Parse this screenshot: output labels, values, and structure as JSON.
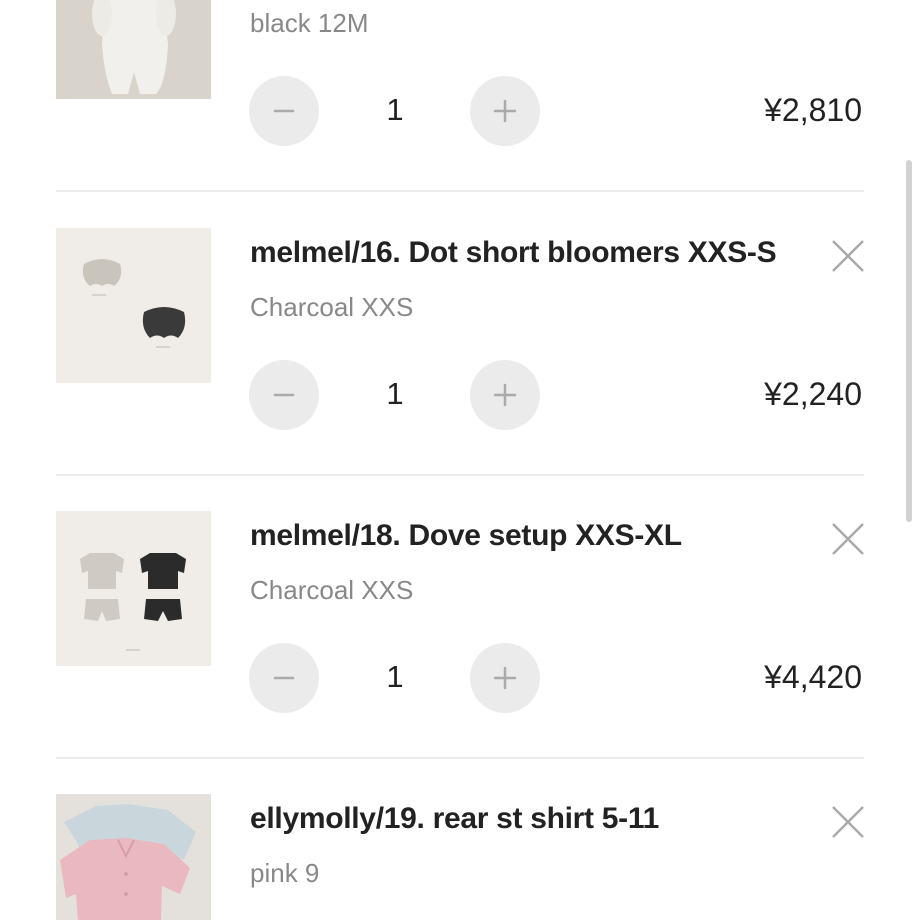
{
  "cart": {
    "items": [
      {
        "title": "",
        "variant": "black 12M",
        "quantity": "1",
        "price": "¥2,810"
      },
      {
        "title": "melmel/16. Dot short bloomers XXS-S",
        "variant": "Charcoal XXS",
        "quantity": "1",
        "price": "¥2,240"
      },
      {
        "title": "melmel/18. Dove setup XXS-XL",
        "variant": "Charcoal XXS",
        "quantity": "1",
        "price": "¥4,420"
      },
      {
        "title": "ellymolly/19. rear st shirt 5-11",
        "variant": "pink 9"
      }
    ]
  },
  "icons": {
    "decrease": "minus-icon",
    "increase": "plus-icon",
    "remove": "close-icon"
  },
  "colors": {
    "text": "#222222",
    "muted_text": "#888888",
    "stepper_background": "#ebebeb",
    "divider": "#ececec",
    "icon_stroke": "#aaaaaa"
  }
}
